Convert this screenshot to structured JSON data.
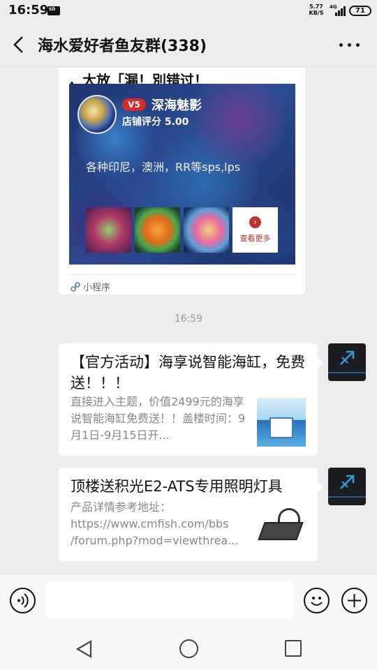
{
  "status_bar": {
    "time": "16:59",
    "sd_label": "SD",
    "net_speed_value": "5.77",
    "net_speed_unit": "KB/S",
    "network_type": "4G",
    "battery": "71"
  },
  "header": {
    "title": "海水爱好者鱼友群(338)"
  },
  "mini_program_card": {
    "title": "，大放「漏！別错过！",
    "shop_level": "V5",
    "shop_name": "深海魅影",
    "shop_rating": "店铺评分 5.00",
    "shop_description": "各种印尼，澳洲，RR等sps,lps",
    "see_more": "查看更多",
    "footer_label": "小程序"
  },
  "timestamp": "16:59",
  "link_cards": [
    {
      "title": "【官方活动】海享说智能海缸，免费送！！！",
      "description": "直接进入主题，价值2499元的海享说智能海缸免费送！！盖楼时间：9月1日-9月15日开..."
    },
    {
      "title": "顶楼送积光E2-ATS专用照明灯具",
      "description_lines": [
        "产品详情参考地址：",
        "https://www.cmfish.com/bbs",
        "/forum.php?mod=viewthrea..."
      ]
    }
  ],
  "input": {
    "value": "",
    "placeholder": ""
  },
  "colors": {
    "background": "#ededed",
    "badge_red": "#d62b2b",
    "avatar_dark": "#1b1d22",
    "avatar_accent": "#2b87c9"
  },
  "icons": {
    "back": "back-icon",
    "more": "more-icon",
    "voice": "voice-icon",
    "emoji": "emoji-icon",
    "plus": "plus-icon",
    "mini_program": "mini-program-icon"
  }
}
